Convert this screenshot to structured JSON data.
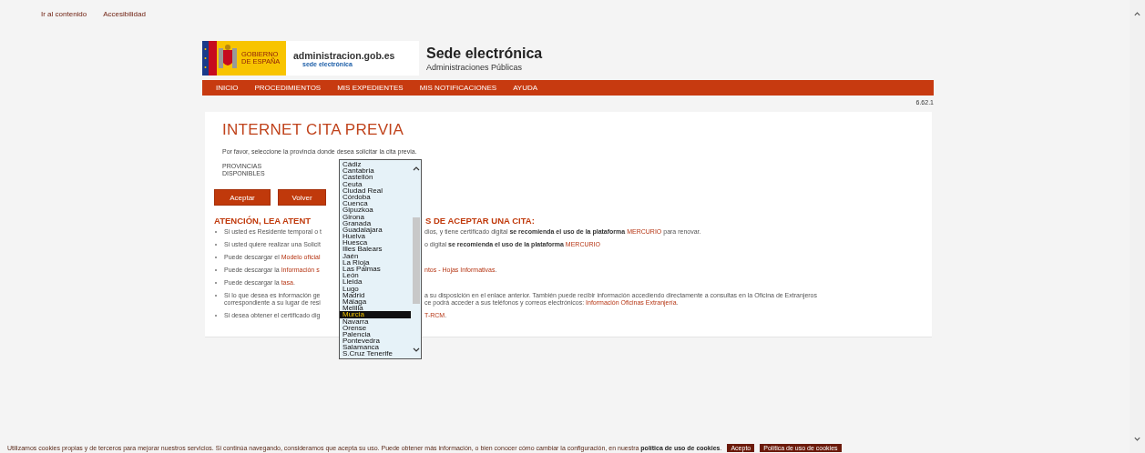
{
  "skip_links": [
    "Ir al contenido",
    "Accesibilidad"
  ],
  "header": {
    "logo_gov_text": "GOBIERNO DE ESPAÑA",
    "logo_admin_text": "administracion.gob.es",
    "logo_admin_sub": "sede electrónica",
    "title": "Sede electrónica",
    "subtitle": "Administraciones Públicas"
  },
  "nav": [
    "INICIO",
    "PROCEDIMIENTOS",
    "MIS EXPEDIENTES",
    "MIS NOTIFICACIONES",
    "AYUDA"
  ],
  "version": "6.62.1",
  "page_title": "INTERNET CITA PREVIA",
  "intro": "Por favor, seleccione la provincia donde desea solicitar la cita previa.",
  "province_label": "PROVINCIAS DISPONIBLES",
  "provinces": [
    {
      "name": "Cádiz",
      "selected": false
    },
    {
      "name": "Cantabria",
      "selected": false
    },
    {
      "name": "Castellón",
      "selected": false
    },
    {
      "name": "Ceuta",
      "selected": false
    },
    {
      "name": "Ciudad Real",
      "selected": false
    },
    {
      "name": "Córdoba",
      "selected": false
    },
    {
      "name": "Cuenca",
      "selected": false
    },
    {
      "name": "Gipuzkoa",
      "selected": false
    },
    {
      "name": "Girona",
      "selected": false
    },
    {
      "name": "Granada",
      "selected": false
    },
    {
      "name": "Guadalajara",
      "selected": false
    },
    {
      "name": "Huelva",
      "selected": false
    },
    {
      "name": "Huesca",
      "selected": false
    },
    {
      "name": "Illes Balears",
      "selected": false
    },
    {
      "name": "Jaén",
      "selected": false
    },
    {
      "name": "La Rioja",
      "selected": false
    },
    {
      "name": "Las Palmas",
      "selected": false
    },
    {
      "name": "León",
      "selected": false
    },
    {
      "name": "Lleida",
      "selected": false
    },
    {
      "name": "Lugo",
      "selected": false
    },
    {
      "name": "Madrid",
      "selected": false
    },
    {
      "name": "Málaga",
      "selected": false
    },
    {
      "name": "Melilla",
      "selected": false
    },
    {
      "name": "Murcia",
      "selected": true
    },
    {
      "name": "Navarra",
      "selected": false
    },
    {
      "name": "Orense",
      "selected": false
    },
    {
      "name": "Palencia",
      "selected": false
    },
    {
      "name": "Pontevedra",
      "selected": false
    },
    {
      "name": "Salamanca",
      "selected": false
    },
    {
      "name": "S.Cruz Tenerife",
      "selected": false
    }
  ],
  "buttons": [
    "Aceptar",
    "Volver"
  ],
  "notice_heading": {
    "left": "ATENCIÓN, LEA ATENT",
    "right": "S DE ACEPTAR UNA CITA:"
  },
  "notices": [
    {
      "left": [
        [
          {
            "kind": "text",
            "text": "Si usted es Residente temporal o t"
          }
        ]
      ],
      "right": [
        [
          {
            "kind": "text",
            "text": "dios, y tiene certificado digital "
          },
          {
            "kind": "strong",
            "text": "se recomienda el uso de la plataforma "
          },
          {
            "kind": "link",
            "text": "MERCURIO"
          },
          {
            "kind": "text",
            "text": " para renovar."
          }
        ]
      ]
    },
    {
      "left": [
        [
          {
            "kind": "text",
            "text": "Si usted quiere realizar una Solicit"
          }
        ]
      ],
      "right": [
        [
          {
            "kind": "text",
            "text": "o digital "
          },
          {
            "kind": "strong",
            "text": "se recomienda el uso de la plataforma "
          },
          {
            "kind": "link",
            "text": "MERCURIO"
          }
        ]
      ]
    },
    {
      "left": [
        [
          {
            "kind": "text",
            "text": "Puede descargar el "
          },
          {
            "kind": "link",
            "text": "Modelo oficial"
          }
        ]
      ]
    },
    {
      "left": [
        [
          {
            "kind": "text",
            "text": "Puede descargar la "
          },
          {
            "kind": "link",
            "text": "Información s"
          }
        ]
      ],
      "right": [
        [
          {
            "kind": "link",
            "text": "ntos - Hojas Informativas"
          },
          {
            "kind": "text",
            "text": "."
          }
        ]
      ]
    },
    {
      "left": [
        [
          {
            "kind": "text",
            "text": "Puede descargar la "
          },
          {
            "kind": "link",
            "text": "tasa"
          },
          {
            "kind": "text",
            "text": "."
          }
        ]
      ]
    },
    {
      "left": [
        [
          {
            "kind": "text",
            "text": "Si lo que desea es información ge"
          }
        ],
        [
          {
            "kind": "text",
            "text": "correspondiente a su lugar de resi"
          }
        ]
      ],
      "right": [
        [
          {
            "kind": "text",
            "text": "a su disposición en el enlace anterior. También puede recibir información accediendo directamente a consultas en la Oficina de Extranjeros"
          }
        ],
        [
          {
            "kind": "text",
            "text": "ce podrá acceder a sus teléfonos y correos electrónicos: "
          },
          {
            "kind": "link",
            "text": "Información Oficinas Extranjería"
          },
          {
            "kind": "text",
            "text": "."
          }
        ]
      ]
    },
    {
      "left": [
        [
          {
            "kind": "text",
            "text": "Si desea obtener el certificado dig"
          }
        ]
      ],
      "right": [
        [
          {
            "kind": "link",
            "text": "T-RCM"
          },
          {
            "kind": "text",
            "text": "."
          }
        ]
      ]
    }
  ],
  "cookie_bar": {
    "text": "Utilizamos cookies propias y de terceros para mejorar nuestros servicios. Si continúa navegando, consideramos que acepta su uso. Puede obtener más información, o bien conocer cómo cambiar la configuración, en nuestra ",
    "link": "política de uso de cookies",
    "after": ".",
    "buttons": [
      "Acepto",
      "Política de uso de cookies"
    ]
  }
}
